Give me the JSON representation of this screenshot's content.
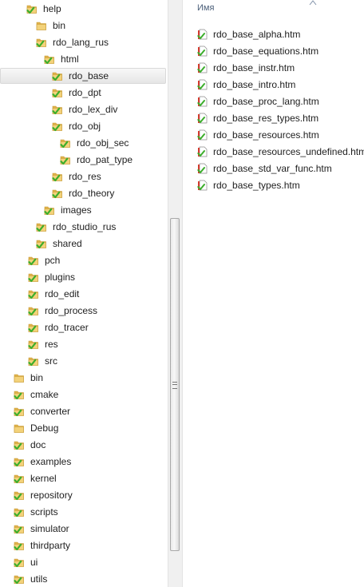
{
  "colors": {
    "folder": "#e8c155",
    "checkmark": "#3cae2c",
    "column_header": "#4c607a"
  },
  "tree": {
    "selected_item": "rdo_base",
    "items": [
      {
        "label": "help",
        "icon": "folder-synced-icon"
      },
      {
        "label": "bin",
        "icon": "folder-icon"
      },
      {
        "label": "rdo_lang_rus",
        "icon": "folder-synced-icon"
      },
      {
        "label": "html",
        "icon": "folder-synced-icon"
      },
      {
        "label": "rdo_base",
        "icon": "folder-synced-icon"
      },
      {
        "label": "rdo_dpt",
        "icon": "folder-synced-icon"
      },
      {
        "label": "rdo_lex_div",
        "icon": "folder-synced-icon"
      },
      {
        "label": "rdo_obj",
        "icon": "folder-synced-icon"
      },
      {
        "label": "rdo_obj_sec",
        "icon": "folder-synced-icon"
      },
      {
        "label": "rdo_pat_type",
        "icon": "folder-synced-icon"
      },
      {
        "label": "rdo_res",
        "icon": "folder-synced-icon"
      },
      {
        "label": "rdo_theory",
        "icon": "folder-synced-icon"
      },
      {
        "label": "images",
        "icon": "folder-synced-icon"
      },
      {
        "label": "rdo_studio_rus",
        "icon": "folder-synced-icon"
      },
      {
        "label": "shared",
        "icon": "folder-synced-icon"
      },
      {
        "label": "pch",
        "icon": "folder-synced-icon"
      },
      {
        "label": "plugins",
        "icon": "folder-synced-icon"
      },
      {
        "label": "rdo_edit",
        "icon": "folder-synced-icon"
      },
      {
        "label": "rdo_process",
        "icon": "folder-synced-icon"
      },
      {
        "label": "rdo_tracer",
        "icon": "folder-synced-icon"
      },
      {
        "label": "res",
        "icon": "folder-synced-icon"
      },
      {
        "label": "src",
        "icon": "folder-synced-icon"
      },
      {
        "label": "bin",
        "icon": "folder-icon"
      },
      {
        "label": "cmake",
        "icon": "folder-synced-icon"
      },
      {
        "label": "converter",
        "icon": "folder-synced-icon"
      },
      {
        "label": "Debug",
        "icon": "folder-icon"
      },
      {
        "label": "doc",
        "icon": "folder-synced-icon"
      },
      {
        "label": "examples",
        "icon": "folder-synced-icon"
      },
      {
        "label": "kernel",
        "icon": "folder-synced-icon"
      },
      {
        "label": "repository",
        "icon": "folder-synced-icon"
      },
      {
        "label": "scripts",
        "icon": "folder-synced-icon"
      },
      {
        "label": "simulator",
        "icon": "folder-synced-icon"
      },
      {
        "label": "thirdparty",
        "icon": "folder-synced-icon"
      },
      {
        "label": "ui",
        "icon": "folder-synced-icon"
      },
      {
        "label": "utils",
        "icon": "folder-synced-icon"
      }
    ]
  },
  "file_list": {
    "column_name": "Имя",
    "sort_icon": "sort-up-arrow-icon",
    "files": [
      {
        "name": "rdo_base_alpha.htm",
        "icon": "html-file-conflict-icon"
      },
      {
        "name": "rdo_base_equations.htm",
        "icon": "html-file-conflict-icon"
      },
      {
        "name": "rdo_base_instr.htm",
        "icon": "html-file-conflict-icon"
      },
      {
        "name": "rdo_base_intro.htm",
        "icon": "html-file-conflict-icon"
      },
      {
        "name": "rdo_base_proc_lang.htm",
        "icon": "html-file-conflict-icon"
      },
      {
        "name": "rdo_base_res_types.htm",
        "icon": "html-file-conflict-icon"
      },
      {
        "name": "rdo_base_resources.htm",
        "icon": "html-file-conflict-icon"
      },
      {
        "name": "rdo_base_resources_undefined.htm",
        "icon": "html-file-conflict-icon"
      },
      {
        "name": "rdo_base_std_var_func.htm",
        "icon": "html-file-conflict-icon"
      },
      {
        "name": "rdo_base_types.htm",
        "icon": "html-file-conflict-icon"
      }
    ]
  }
}
